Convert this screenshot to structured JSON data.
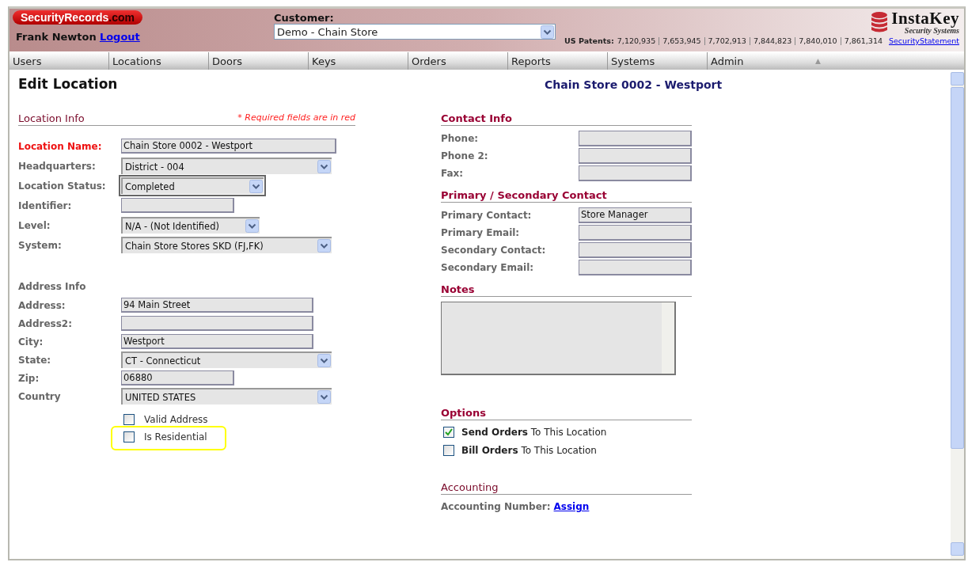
{
  "header": {
    "brand": "SecurityRecords",
    "brand_tld": ".com",
    "user": "Frank Newton",
    "logout": "Logout",
    "customer_label": "Customer:",
    "customer_value": "Demo - Chain Store",
    "company": "InstaKey",
    "company_tagline": "Security Systems",
    "patents_label": "US Patents:",
    "patents": [
      "7,120,935",
      "7,653,945",
      "7,702,913",
      "7,844,823",
      "7,840,010",
      "7,861,314"
    ],
    "statement_link": "SecurityStatement"
  },
  "menu": [
    {
      "label": "Users"
    },
    {
      "label": "Locations"
    },
    {
      "label": "Doors"
    },
    {
      "label": "Keys"
    },
    {
      "label": "Orders"
    },
    {
      "label": "Reports"
    },
    {
      "label": "Systems"
    },
    {
      "label": "Admin"
    }
  ],
  "menu_arrow": "▲",
  "page": {
    "title": "Edit Location",
    "subtitle": "Chain Store 0002 - Westport"
  },
  "location_info": {
    "heading": "Location Info",
    "required_note": "* Required fields are in red",
    "fields": [
      {
        "label": "Location Name:",
        "kind": "text",
        "required": true,
        "value": "Chain Store 0002 - Westport"
      },
      {
        "label": "Headquarters:",
        "kind": "select",
        "required": false,
        "value": "District - 004"
      },
      {
        "label": "Location Status:",
        "kind": "select",
        "required": false,
        "value": "Completed"
      },
      {
        "label": "Identifier:",
        "kind": "text",
        "required": false
      },
      {
        "label": "Level:",
        "kind": "select",
        "required": false,
        "value": "N/A - (Not Identified)"
      },
      {
        "label": "System:",
        "kind": "select",
        "required": false,
        "value": "Chain Store Stores SKD (FJ,FK)"
      }
    ]
  },
  "address_info": {
    "heading": "Address Info",
    "fields": [
      {
        "label": "Address:",
        "kind": "text",
        "value": "94 Main Street"
      },
      {
        "label": "Address2:",
        "kind": "text"
      },
      {
        "label": "City:",
        "kind": "text",
        "value": "Westport"
      },
      {
        "label": "State:",
        "kind": "select",
        "value": "CT - Connecticut"
      },
      {
        "label": "Zip:",
        "kind": "text",
        "value": "06880"
      },
      {
        "label": "Country",
        "kind": "select",
        "value": "UNITED STATES"
      }
    ],
    "checkboxes": [
      {
        "label": "Valid Address",
        "checked": false
      },
      {
        "label": "Is Residential",
        "checked": false
      }
    ]
  },
  "contact_info": {
    "heading": "Contact Info",
    "fields": [
      {
        "label": "Phone:"
      },
      {
        "label": "Phone 2:"
      },
      {
        "label": "Fax:"
      }
    ]
  },
  "contacts": {
    "heading": "Primary / Secondary Contact",
    "fields": [
      {
        "label": "Primary Contact:",
        "value": "Store Manager"
      },
      {
        "label": "Primary Email:"
      },
      {
        "label": "Secondary Contact:"
      },
      {
        "label": "Secondary Email:"
      }
    ]
  },
  "notes": {
    "heading": "Notes"
  },
  "options": {
    "heading": "Options",
    "checkboxes": [
      {
        "label": "**Send Orders** To This Location",
        "checked": true
      },
      {
        "label": "**Bill Orders** To This Location",
        "checked": false
      }
    ]
  },
  "accounting": {
    "heading": "Accounting",
    "label": "Accounting Number:",
    "link": "Assign"
  }
}
